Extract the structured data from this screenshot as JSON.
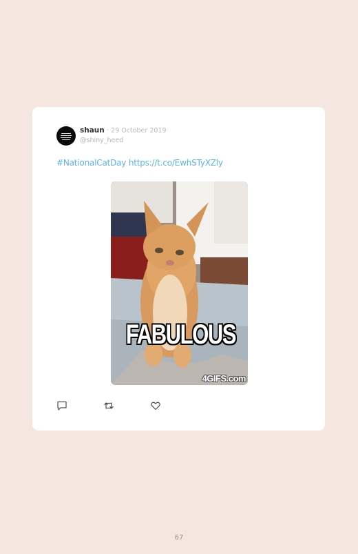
{
  "tweet": {
    "author_name": "shaun",
    "separator": "·",
    "date": "29 October 2019",
    "handle": "@shiny_heed",
    "hashtag": "#NationalCatDay",
    "link": "https://t.co/EwhSTyXZly",
    "media": {
      "caption": "FABULOUS",
      "watermark": "4GIFS.com"
    },
    "actions": [
      "reply-icon",
      "retweet-icon",
      "like-icon"
    ]
  },
  "page_number": "67",
  "colors": {
    "page_background": "#f5e7df",
    "card_background": "#ffffff",
    "link": "#58b4ec"
  }
}
